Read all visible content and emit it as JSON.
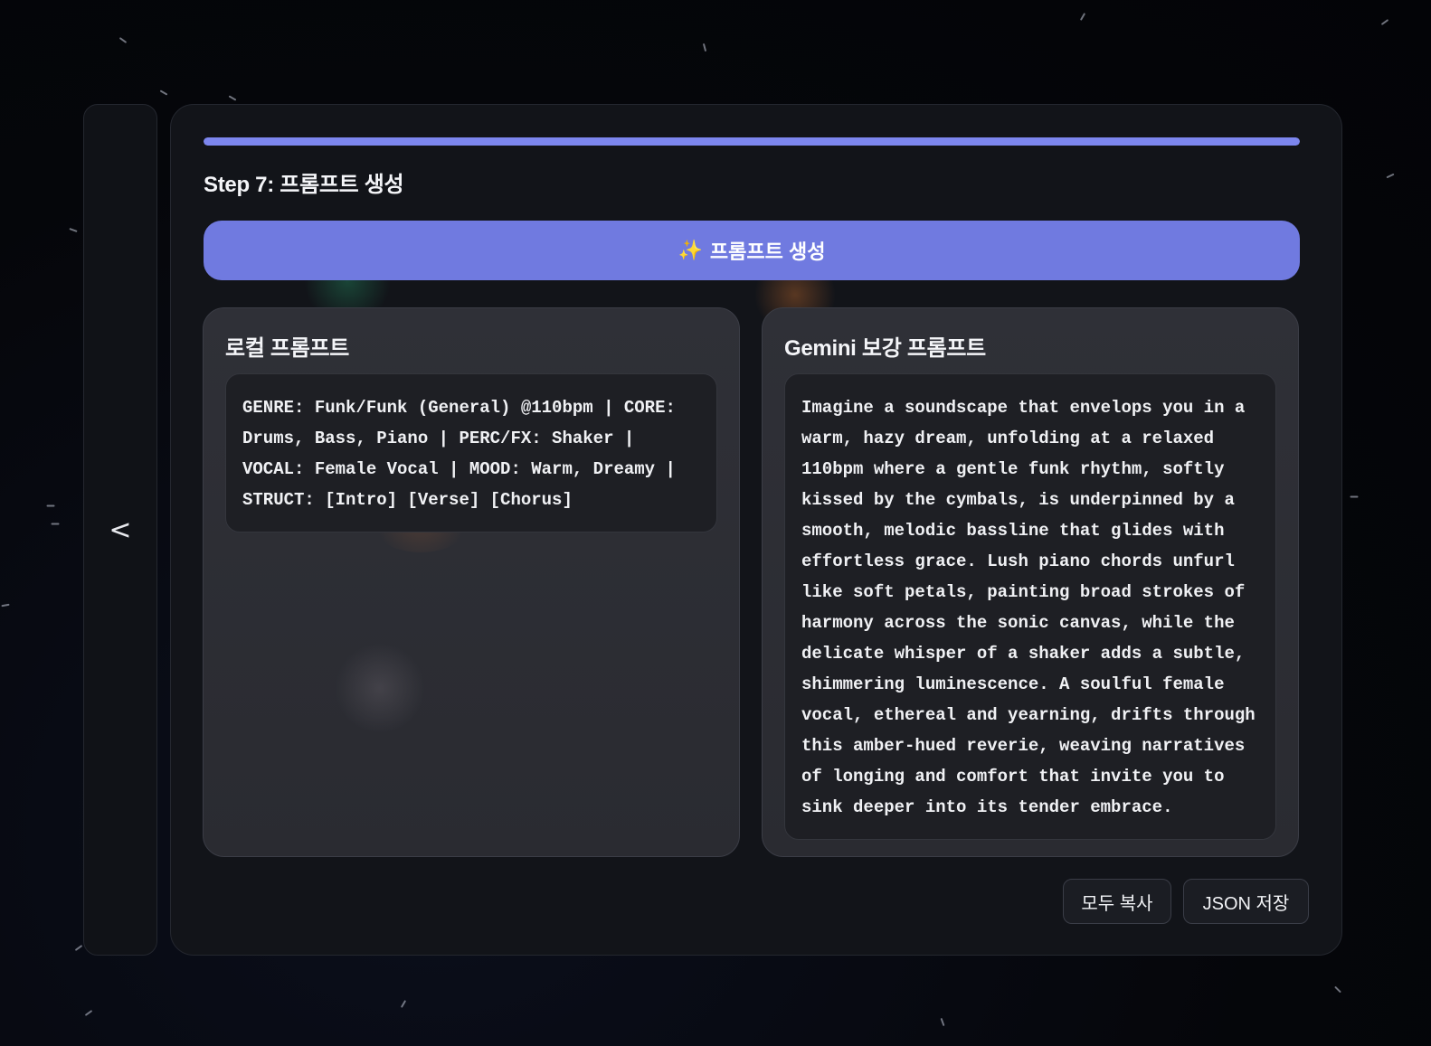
{
  "side_panel": {
    "back_glyph": "<"
  },
  "progress": {
    "fraction": 1.0
  },
  "step": {
    "title": "Step 7: 프롬프트 생성"
  },
  "generate_button": {
    "icon": "sparkles-icon",
    "icon_glyph": "✨",
    "label": "프롬프트 생성"
  },
  "local_prompt": {
    "title": "로컬 프롬프트",
    "text": "GENRE: Funk/Funk (General) @110bpm | CORE: Drums, Bass, Piano | PERC/FX: Shaker | VOCAL: Female Vocal | MOOD: Warm, Dreamy | STRUCT: [Intro] [Verse] [Chorus]"
  },
  "gemini_prompt": {
    "title": "Gemini 보강 프롬프트",
    "text": "Imagine a soundscape that envelops you in a warm, hazy dream, unfolding at a relaxed 110bpm where a gentle funk rhythm, softly kissed by the cymbals, is underpinned by a smooth, melodic bassline that glides with effortless grace. Lush piano chords unfurl like soft petals, painting broad strokes of harmony across the sonic canvas, while the delicate whisper of a shaker adds a subtle, shimmering luminescence. A soulful female vocal, ethereal and yearning, drifts through this amber-hued reverie, weaving narratives of longing and comfort that invite you to sink deeper into its tender embrace."
  },
  "actions": {
    "copy_all": "모두 복사",
    "save_json": "JSON 저장"
  },
  "colors": {
    "accent": "#707ae0",
    "progress": "#7c86ee",
    "background": "#05060a",
    "card": "#121419",
    "panel": "#2d2e34"
  }
}
